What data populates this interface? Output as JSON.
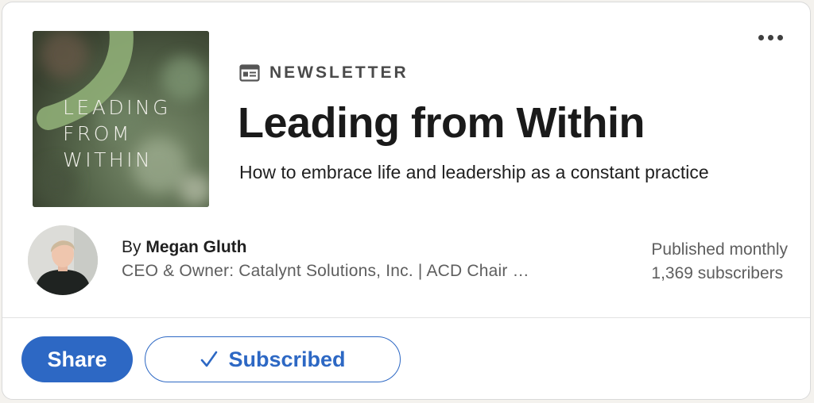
{
  "newsletter": {
    "cover": {
      "lines": [
        "LEADING",
        "FROM",
        "WITHIN"
      ]
    },
    "label": "NEWSLETTER",
    "label_icon": "newsletter-icon",
    "title": "Leading from Within",
    "description": "How to embrace life and leadership as a constant practice",
    "menu_icon": "more-options-icon"
  },
  "author": {
    "by_prefix": "By ",
    "name": "Megan Gluth",
    "headline": "CEO & Owner: Catalynt Solutions, Inc. | ACD Chair …"
  },
  "meta": {
    "frequency": "Published monthly",
    "subscribers": "1,369 subscribers"
  },
  "actions": {
    "share_label": "Share",
    "subscribed_label": "Subscribed",
    "subscribed_icon": "checkmark-icon"
  },
  "colors": {
    "accent": "#2d68c4",
    "card_background": "#ffffff",
    "page_background": "#f4f2ee"
  }
}
